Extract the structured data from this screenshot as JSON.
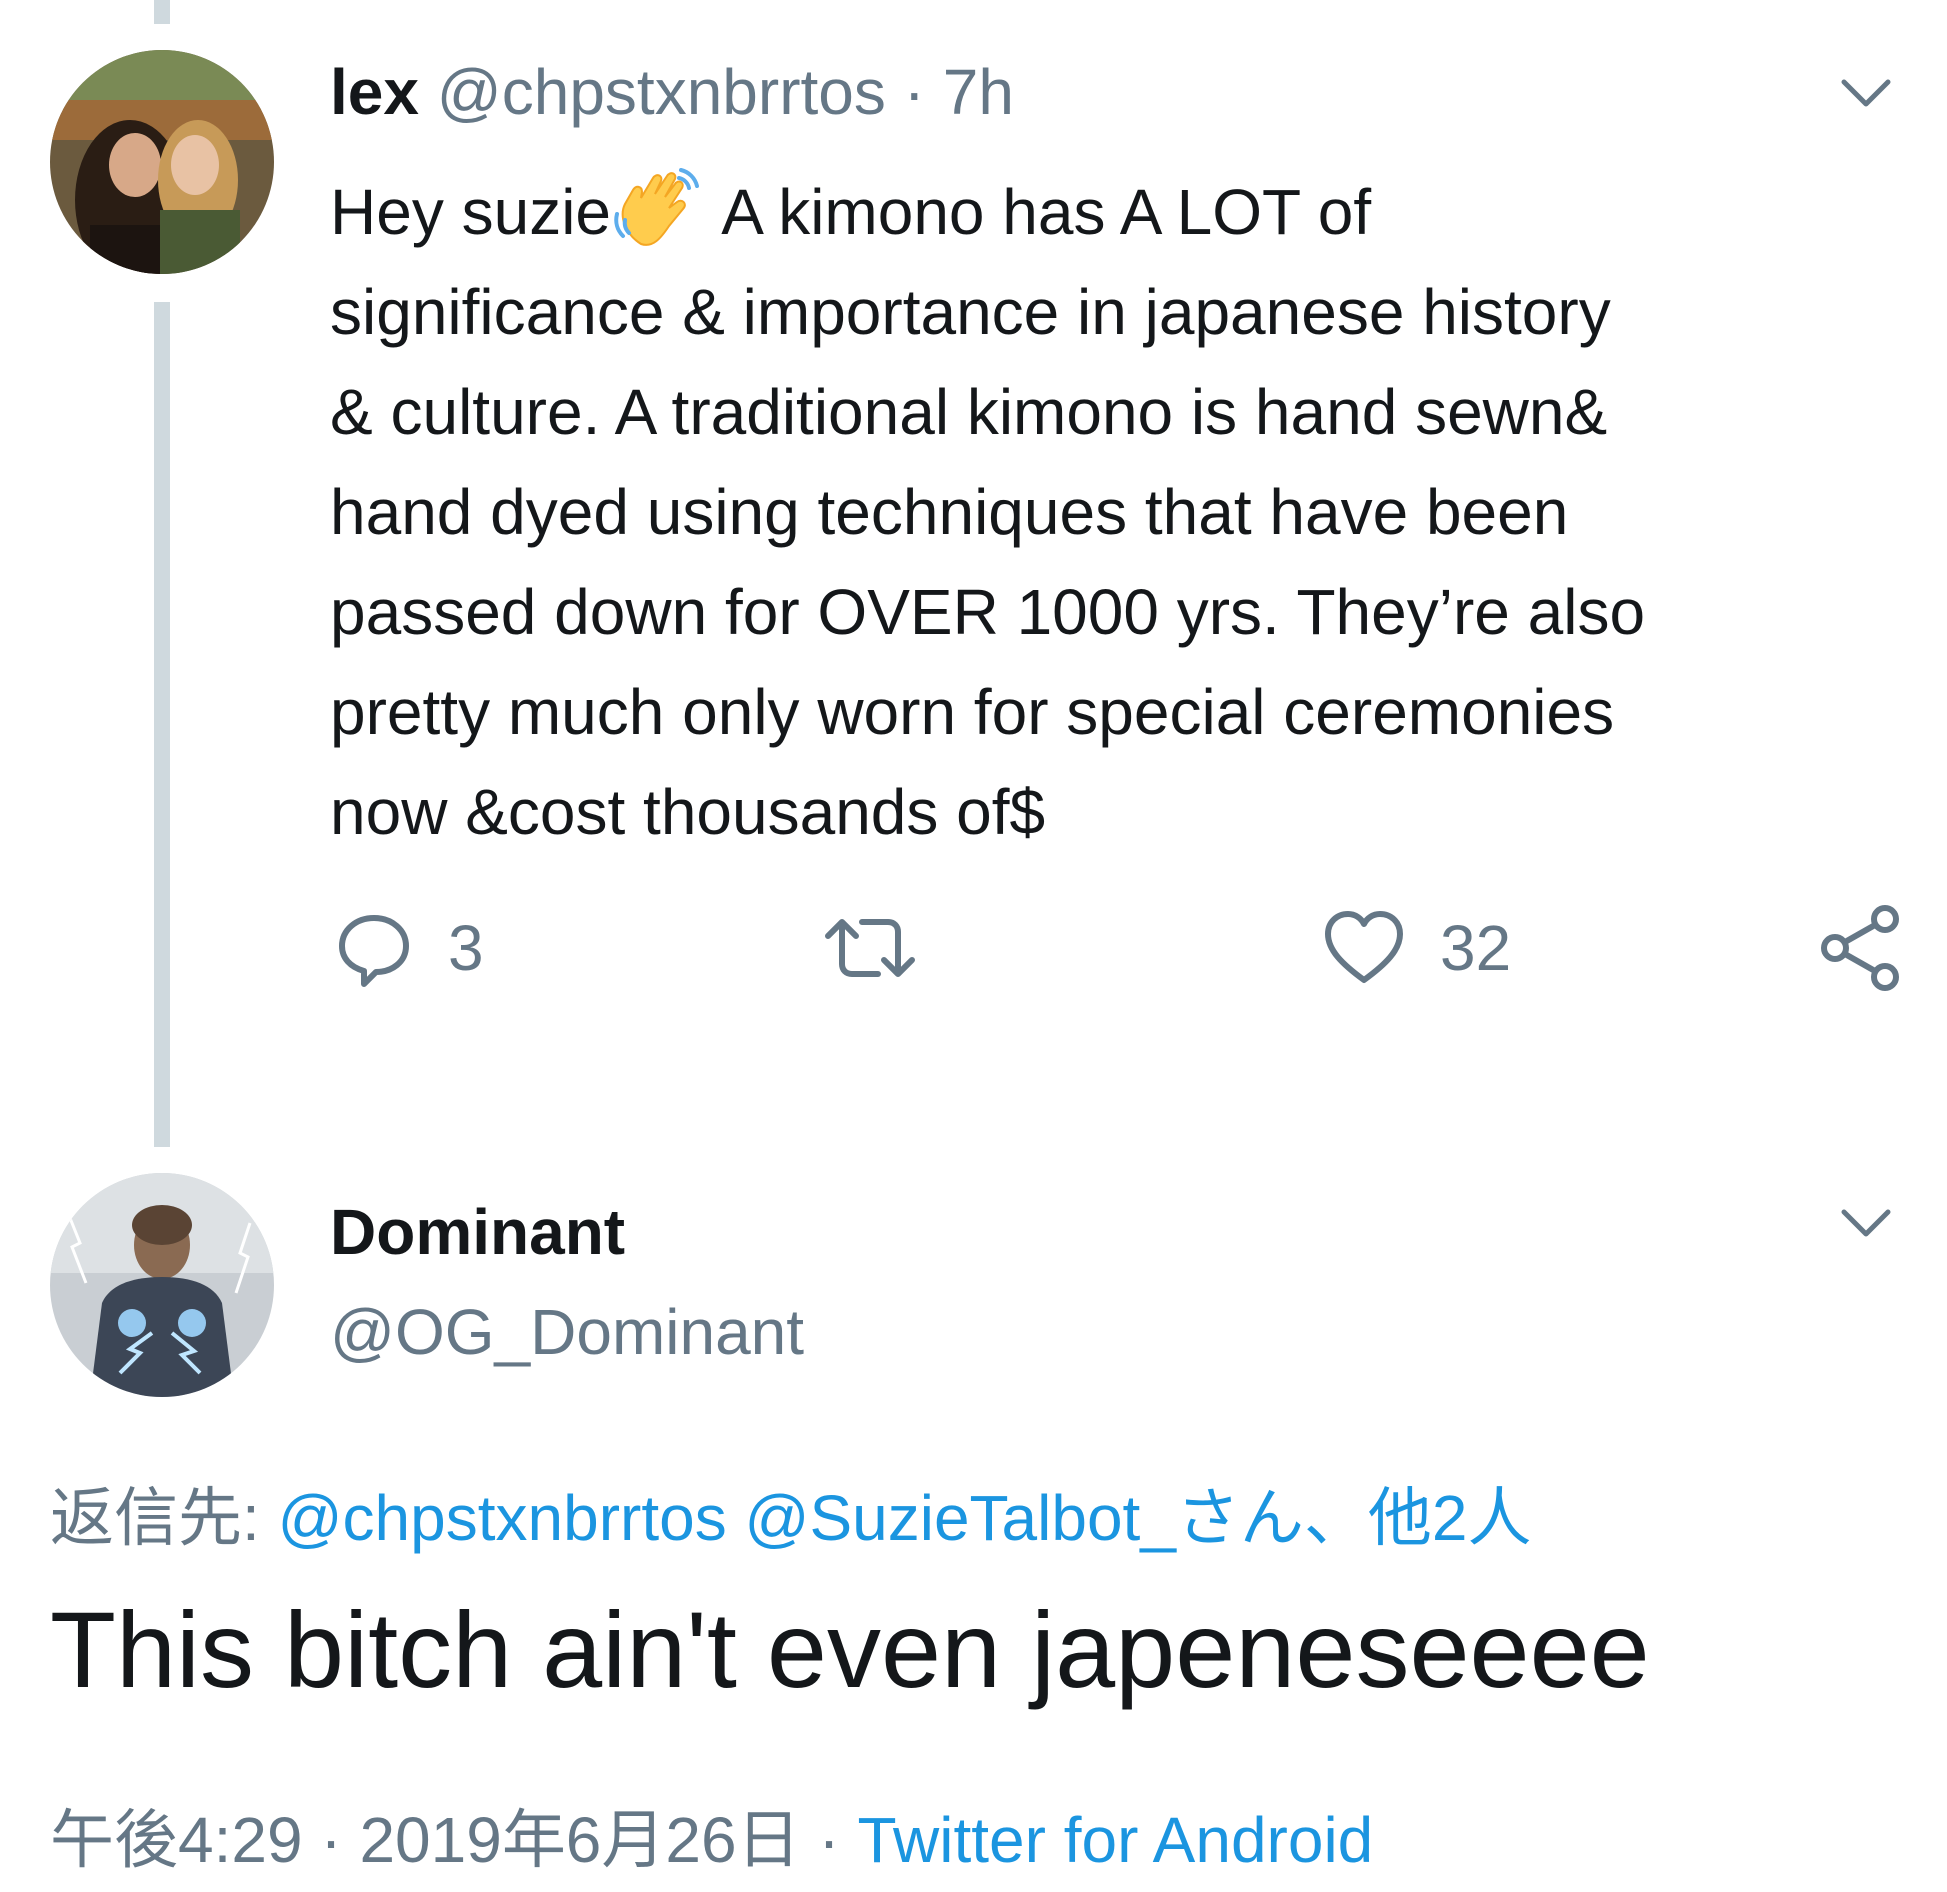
{
  "tweet1": {
    "display_name": "lex",
    "handle": "@chpstxnbrrtos",
    "separator": "·",
    "time": "7h",
    "text_lines": {
      "l1a": "Hey suzie",
      "l1b": " A kimono has A LOT of",
      "l2": "significance & importance in japanese history",
      "l3": "& culture. A traditional kimono is hand sewn&",
      "l4": "hand dyed using techniques that have been",
      "l5": "passed down for OVER 1000 yrs. They’re also",
      "l6": "pretty much only worn for special ceremonies",
      "l7": "now &cost thousands of$"
    },
    "emoji": "waving-hand",
    "reply_count": "3",
    "retweet_count": "",
    "like_count": "32"
  },
  "tweet2": {
    "display_name": "Dominant",
    "handle": "@OG_Dominant",
    "reply_to_label": "返信先:",
    "reply_to_user1": "@chpstxnbrrtos",
    "reply_to_user2": "@SuzieTalbot_",
    "reply_to_suffix": "さん、他2人",
    "text": "This bitch ain't even japeneseeee",
    "time": "午後4:29",
    "separator": "·",
    "date": "2019年6月26日",
    "source": "Twitter for Android"
  },
  "colors": {
    "text": "#14171a",
    "muted": "#657786",
    "link": "#1b95e0",
    "thread_line": "#cfd9de"
  }
}
